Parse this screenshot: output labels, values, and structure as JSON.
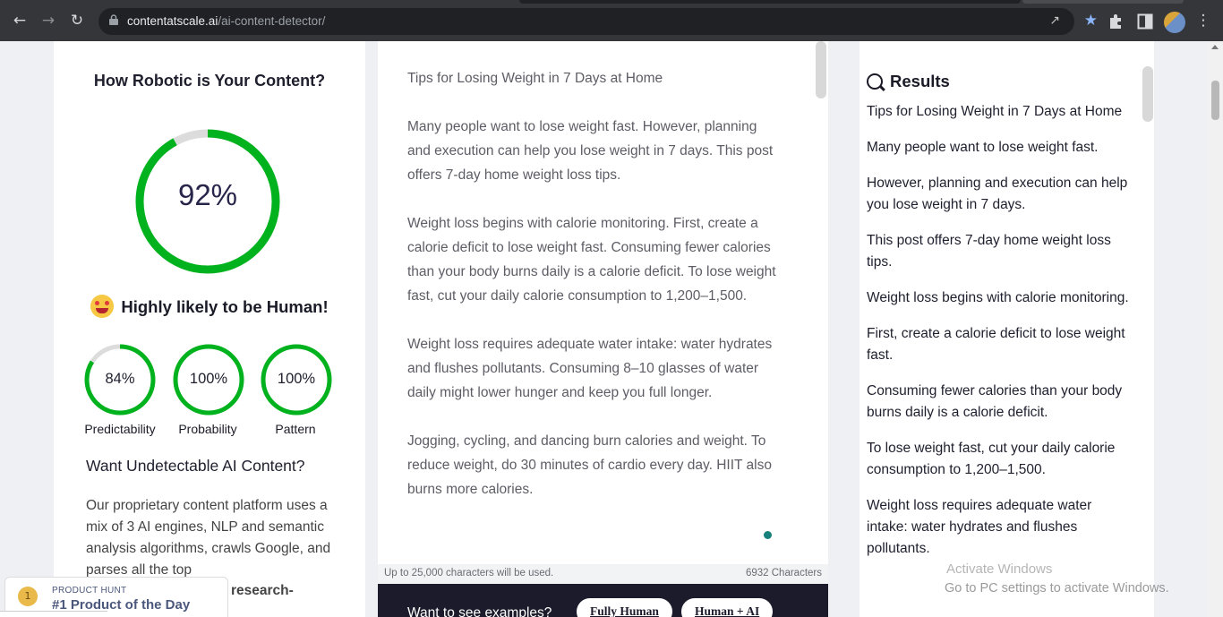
{
  "browser": {
    "url_domain": "contentatscale.ai",
    "url_path": "/ai-content-detector/"
  },
  "left": {
    "title": "How Robotic is Your Content?",
    "score": "92%",
    "score_value": 0.92,
    "verdict": "Highly likely to be Human!",
    "metrics": [
      {
        "value": "84%",
        "fraction": 0.84,
        "label": "Predictability"
      },
      {
        "value": "100%",
        "fraction": 1.0,
        "label": "Probability"
      },
      {
        "value": "100%",
        "fraction": 1.0,
        "label": "Pattern"
      }
    ],
    "promo_title": "Want Undetectable AI Content?",
    "promo_text": "Our proprietary content platform uses a mix of 3 AI engines, NLP and semantic analysis algorithms, crawls Google, and parses all the top",
    "promo_text_cont": "research-",
    "gauge_color": "#00b31e",
    "gauge_track_color": "#dcdcdc"
  },
  "product_hunt": {
    "rank": "1",
    "kicker": "PRODUCT HUNT",
    "title": "#1 Product of the Day"
  },
  "middle": {
    "paragraphs": [
      "Tips for Losing Weight in 7 Days at Home",
      "Many people want to lose weight fast. However, planning and execution can help you lose weight in 7 days. This post offers 7-day home weight loss tips.",
      "Weight loss begins with calorie monitoring. First, create a calorie deficit to lose weight fast. Consuming fewer calories than your body burns daily is a calorie deficit. To lose weight fast, cut your daily calorie consumption to 1,200–1,500.",
      "Weight loss requires adequate water intake: water hydrates and flushes pollutants. Consuming 8–10 glasses of water daily might lower hunger and keep you full longer.",
      "Jogging, cycling, and dancing burn calories and weight. To reduce weight, do 30 minutes of cardio every day. HIIT also burns more calories."
    ],
    "char_limit_note": "Up to 25,000 characters will be used.",
    "char_count": "6932 Characters",
    "examples_prompt": "Want to see examples?",
    "example_buttons": [
      "Fully Human",
      "Human + AI"
    ]
  },
  "results": {
    "heading": "Results",
    "items": [
      "Tips for Losing Weight in 7 Days at Home",
      "Many people want to lose weight fast.",
      "However, planning and execution can help you lose weight in 7 days.",
      "This post offers 7-day home weight loss tips.",
      "Weight loss begins with calorie monitoring.",
      "First, create a calorie deficit to lose weight fast.",
      "Consuming fewer calories than your body burns daily is a calorie deficit.",
      "To lose weight fast, cut your daily calorie consumption to 1,200–1,500.",
      "Weight loss requires adequate water intake: water hydrates and flushes pollutants."
    ]
  },
  "watermark": {
    "line1": "Activate Windows",
    "line2": "Go to PC settings to activate Windows."
  }
}
